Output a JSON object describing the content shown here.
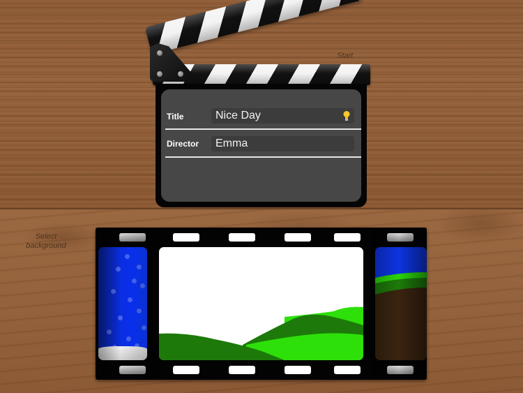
{
  "hints": {
    "start": "Start",
    "select_background": "Select background"
  },
  "slate": {
    "fields": [
      {
        "label": "Title",
        "value": "Nice Day",
        "icon": "lightbulb-icon"
      },
      {
        "label": "Director",
        "value": "Emma"
      }
    ]
  },
  "film_strip": {
    "frames": [
      {
        "name": "snow-night",
        "colors": {
          "sky": "#0a33ff",
          "ground": "#d8d8d8"
        }
      },
      {
        "name": "green-hills",
        "selected": true,
        "colors": {
          "sky": "#ffffff",
          "hill_dark": "#1d7a0a",
          "hill_light": "#2ee00a"
        }
      },
      {
        "name": "grass-dirt",
        "colors": {
          "sky": "#0d34e0",
          "grass": "#2ad40a",
          "dirt": "#3a2410"
        }
      }
    ]
  },
  "colors": {
    "slate_panel": "#474747",
    "field_bg": "#3c3c3c",
    "hint_text": "#4f3420"
  }
}
